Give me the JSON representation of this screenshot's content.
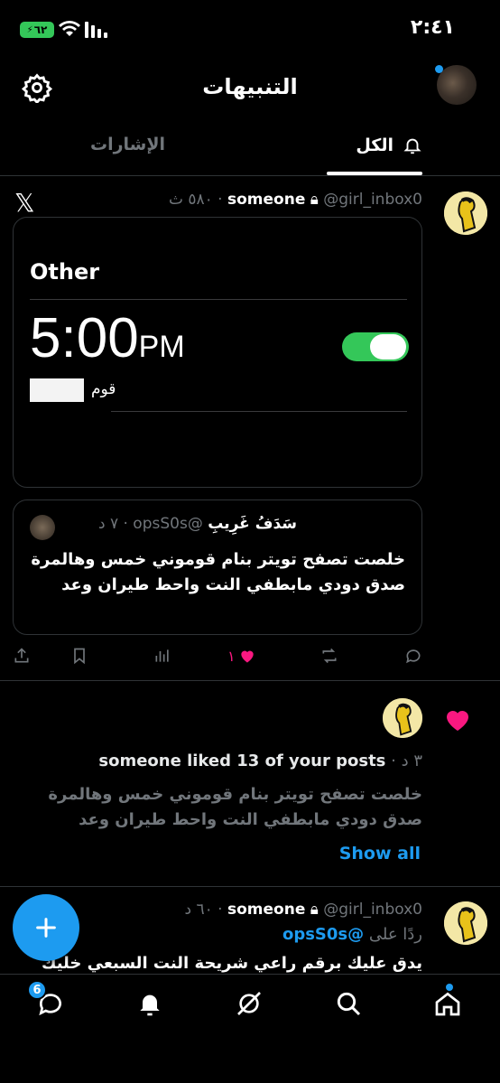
{
  "status_bar": {
    "time": "٢:٤١",
    "battery": "٦٢"
  },
  "header": {
    "title": "التنبيهات"
  },
  "tabs": {
    "all": "الكل",
    "mentions": "الإشارات"
  },
  "post1": {
    "name": "someone",
    "handle": "@girl_inbox0",
    "time": "٥٨٠ ث",
    "image": {
      "label": "Other",
      "time": "5:00",
      "ampm": "PM",
      "sub": "قوم"
    },
    "quote": {
      "name": "سَدَفُ غَرِيبِ",
      "handle": "@opsS0s",
      "time": "٧ د",
      "text": "خلصت تصفح تويتر بنام قوموني خمس وهالمرة صدق دودي مابطفي النت واحط طيران وعد"
    },
    "likes": "١"
  },
  "like_notification": {
    "text": "someone liked 13 of your posts",
    "time": "٣ د",
    "quote": "خلصت تصفح تويتر بنام قوموني خمس وهالمرة صدق دودي مابطفي النت واحط طيران وعد",
    "show_all": "Show all"
  },
  "post2": {
    "name": "someone",
    "handle": "@girl_inbox0",
    "time": "٦٠ د",
    "reply_prefix": "ردًا على",
    "reply_mention": "@opsS0s",
    "text": "يدق عليك برقم راعي شريحة النت السبعي خليك"
  },
  "bottom_nav": {
    "messages_badge": "6"
  },
  "colors": {
    "accent": "#1d9bf0",
    "like": "#f91880",
    "toggle": "#34c759"
  }
}
